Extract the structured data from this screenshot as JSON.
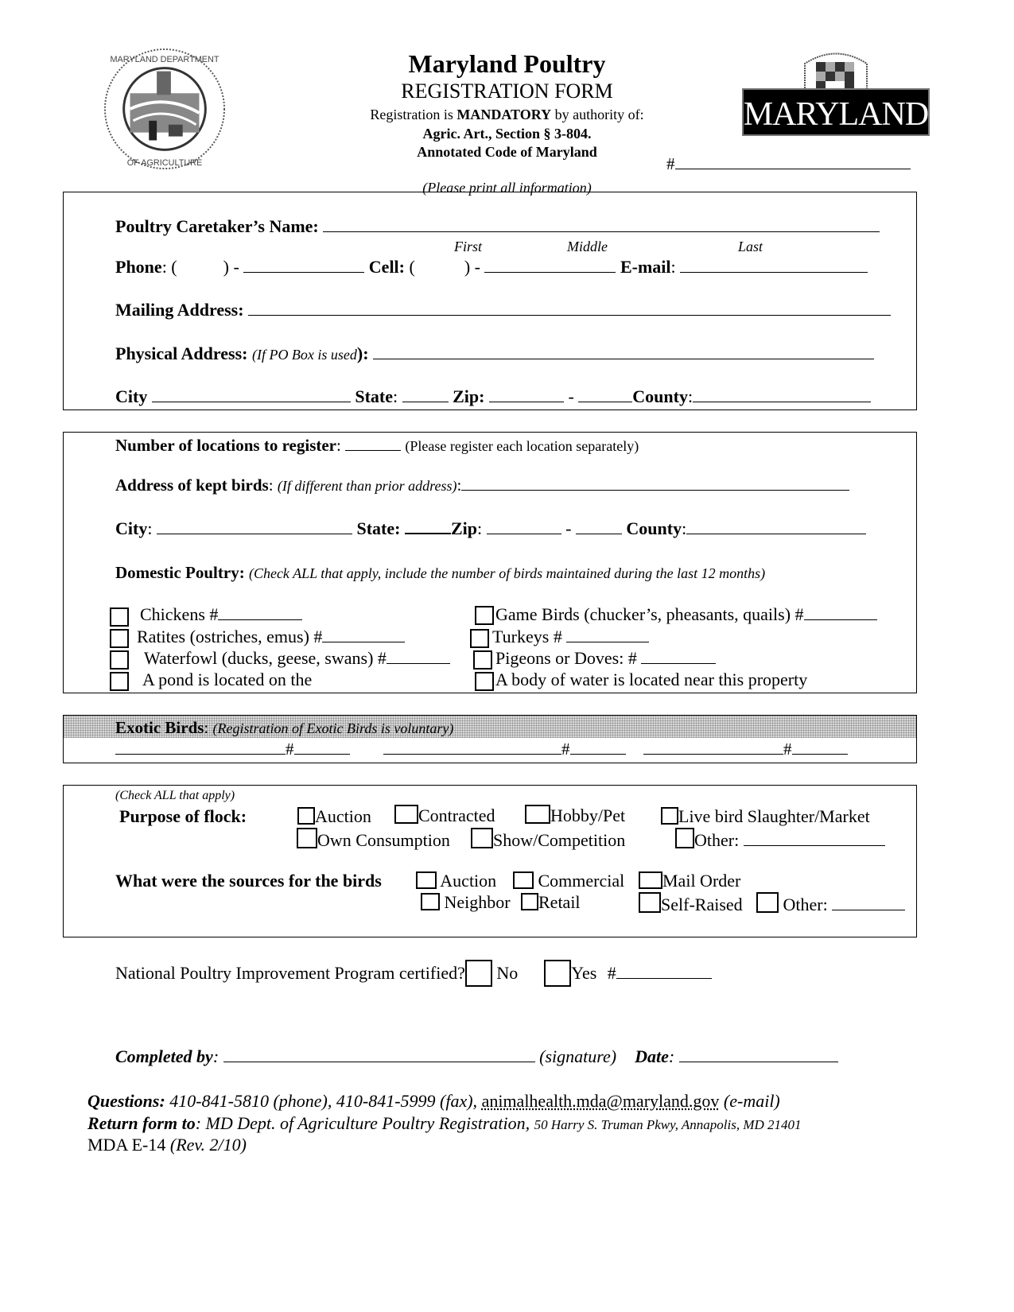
{
  "header": {
    "title": "Maryland Poultry",
    "subtitle": "REGISTRATION FORM",
    "authority_prefix": "Registration is ",
    "authority_bold": "MANDATORY",
    "authority_suffix": " by authority of:",
    "statute_line1": "Agric. Art., Section § 3-804.",
    "statute_line2": "Annotated Code of Maryland",
    "instruction": "(Please print all information)",
    "number_label": "#",
    "left_logo": "maryland-department-of-agriculture-seal",
    "left_logo_text_top": "MARYLAND DEPARTMENT",
    "left_logo_text_bottom": "OF AGRICULTURE",
    "right_logo": "maryland-state-logo",
    "right_logo_text": "MARYLAND"
  },
  "caretaker": {
    "name_label": "Poultry Caretaker’s Name:",
    "name_hints": [
      "First",
      "Middle",
      "Last"
    ],
    "phone_label": "Phone",
    "phone_paren_open": ": (",
    "phone_paren_close": ") -",
    "cell_label": "Cell:",
    "cell_paren_open": "(",
    "cell_paren_close": ") -",
    "email_label": "E-mail",
    "colon": ":",
    "mailing_label": "Mailing Address:",
    "physical_label": "Physical Address:",
    "physical_note": "(If PO Box is used",
    "physical_close": "):",
    "city_label": "City",
    "state_label": "State",
    "zip_label": "Zip:",
    "dash": "-",
    "county_label": "County"
  },
  "locations": {
    "count_label": "Number of locations to register",
    "count_note": "(Please register each location separately)",
    "kept_label": "Address of kept birds",
    "kept_note": "(If different than prior address)",
    "city_label": "City",
    "state_label": "State:",
    "zip_label": "Zip",
    "dash": "-",
    "county_label": "County",
    "domestic_label": "Domestic Poultry:",
    "domestic_note": "(Check ALL that apply, include the number of birds maintained during the last 12 months)",
    "left_items": [
      "Chickens #",
      "Ratites (ostriches, emus) #",
      "Waterfowl (ducks, geese, swans) #",
      "A pond is located on the"
    ],
    "right_items": [
      "Game Birds (chucker’s, pheasants, quails) #",
      "Turkeys # ",
      "Pigeons or Doves:  # ",
      "A body of water is located near this property"
    ]
  },
  "exotic": {
    "label": "Exotic Birds",
    "note": "(Registration of Exotic Birds is voluntary)",
    "hash": "#"
  },
  "purpose": {
    "check_all": "(Check ALL that apply)",
    "label": "Purpose of flock:",
    "options_row1": [
      "Auction",
      "Contracted",
      "Hobby/Pet",
      "Live bird Slaughter/Market"
    ],
    "options_row2": [
      "Own Consumption",
      "Show/Competition",
      "Other:"
    ],
    "sources_label": "What were the sources for the birds",
    "sources_row1": [
      "Auction",
      "Commercial",
      "Mail Order"
    ],
    "sources_row2": [
      "Neighbor",
      "Retail",
      "Self-Raised",
      "Other:"
    ]
  },
  "npip": {
    "question": "National Poultry Improvement Program certified?",
    "no": "No",
    "yes": "Yes",
    "hash": "#"
  },
  "signature": {
    "completed_label": "Completed by",
    "signature_hint": "(signature)",
    "date_label": "Date",
    "colon": ":"
  },
  "footer": {
    "questions_label": "Questions:",
    "questions_text": " 410-841-5810 (phone), 410-841-5999 (fax), ",
    "email": "animalhealth.mda@maryland.gov",
    "email_suffix": " (e-mail)",
    "return_label": "Return form to",
    "return_text": ": MD Dept. of Agriculture Poultry Registration, ",
    "return_address": "50 Harry S. Truman Pkwy, Annapolis, MD  21401",
    "form_id": "MDA E-14 ",
    "revision": "(Rev. 2/10)"
  }
}
